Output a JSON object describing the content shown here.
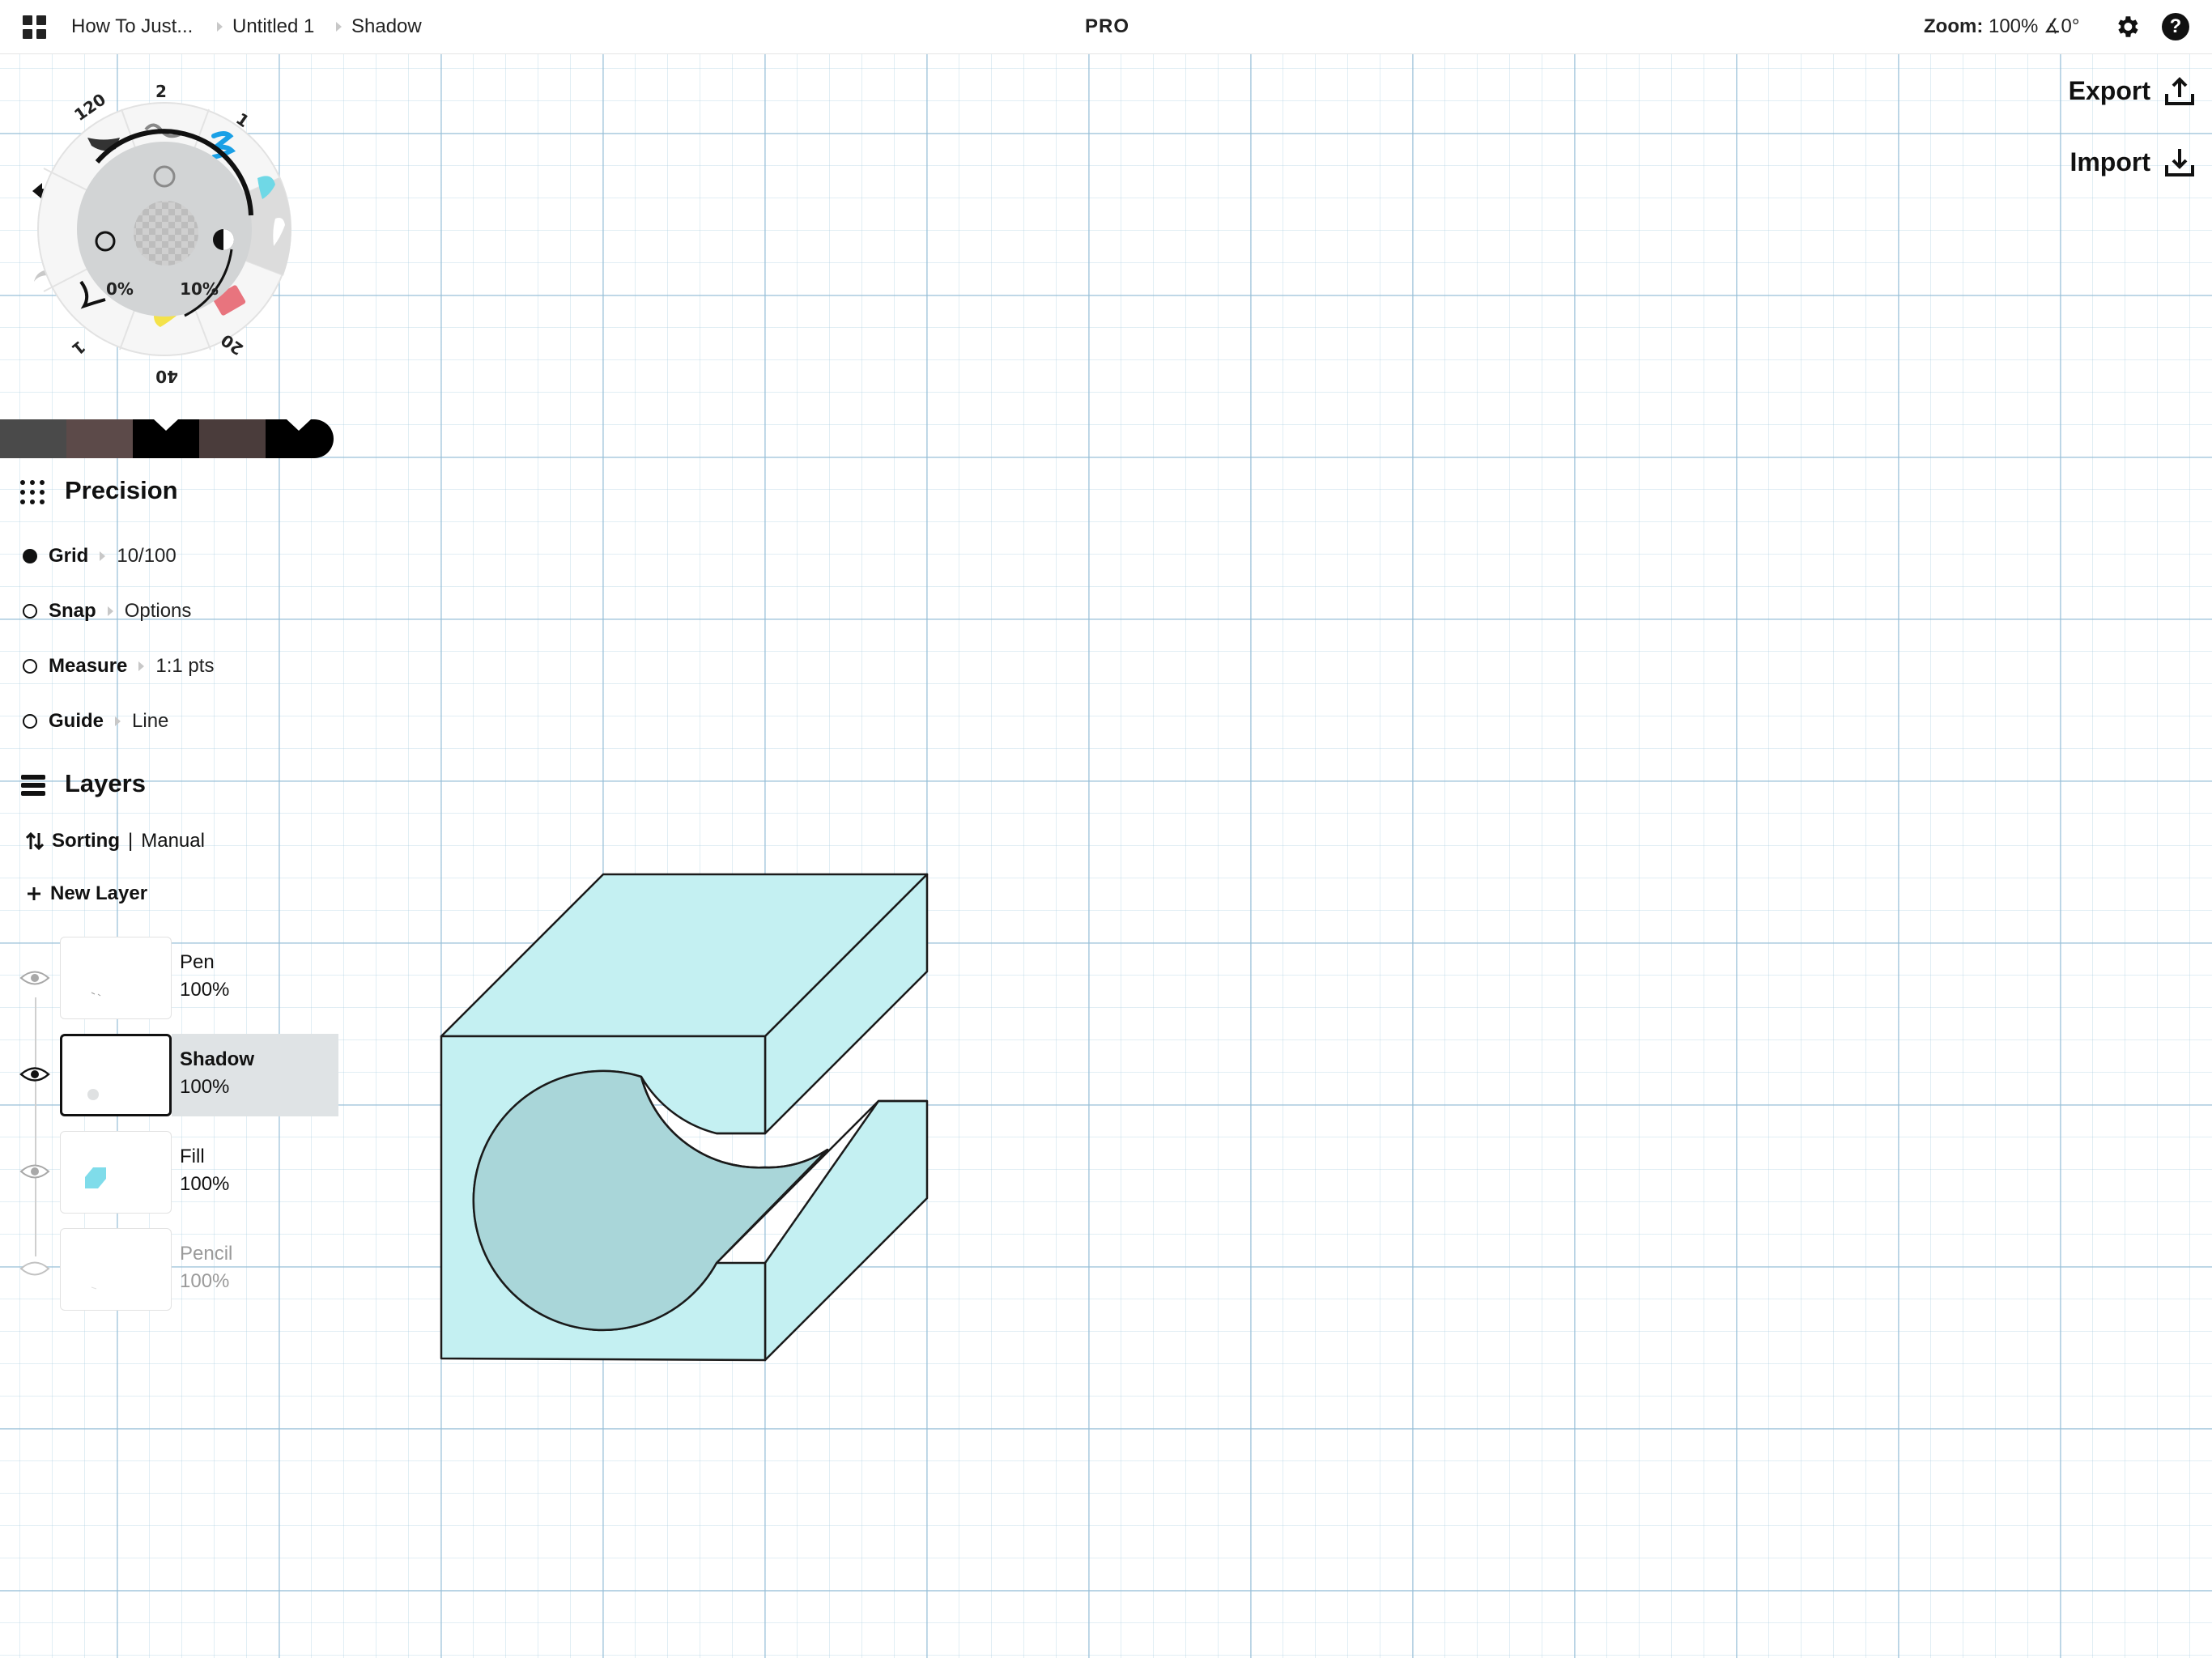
{
  "topbar": {
    "breadcrumbs": [
      "How To Just...",
      "Untitled 1",
      "Shadow"
    ],
    "center_label": "PRO",
    "zoom_label": "Zoom:",
    "zoom_value": "100% ∡0°",
    "icons": [
      "apps-grid-icon",
      "gear-icon",
      "help-icon"
    ]
  },
  "actions": {
    "export_label": "Export",
    "import_label": "Import"
  },
  "tool_wheel": {
    "brush_sizes": [
      "120",
      "2",
      "1",
      "20",
      "40",
      "1"
    ],
    "opacity_left": "0%",
    "opacity_right": "10%"
  },
  "palette": {
    "colors": [
      "#4a4a4a",
      "#5c4a49",
      "#000000",
      "#4a3c3b",
      "#000000"
    ]
  },
  "precision": {
    "title": "Precision",
    "rows": [
      {
        "label": "Grid",
        "value": "10/100",
        "on": true
      },
      {
        "label": "Snap",
        "value": "Options",
        "on": false
      },
      {
        "label": "Measure",
        "value": "1:1 pts",
        "on": false
      },
      {
        "label": "Guide",
        "value": "Line",
        "on": false
      }
    ]
  },
  "layers": {
    "title": "Layers",
    "sorting_label": "Sorting",
    "sorting_divider": "|",
    "sorting_value": "Manual",
    "new_layer_label": "New Layer",
    "items": [
      {
        "name": "Pen",
        "opacity": "100%"
      },
      {
        "name": "Shadow",
        "opacity": "100%"
      },
      {
        "name": "Fill",
        "opacity": "100%"
      },
      {
        "name": "Pencil",
        "opacity": "100%"
      }
    ]
  },
  "colors": {
    "fill": "#c4f0f2",
    "shadow": "#a9d6d9",
    "stroke": "#1a1a1a",
    "active_layer_bg": "#dfe3e5"
  }
}
